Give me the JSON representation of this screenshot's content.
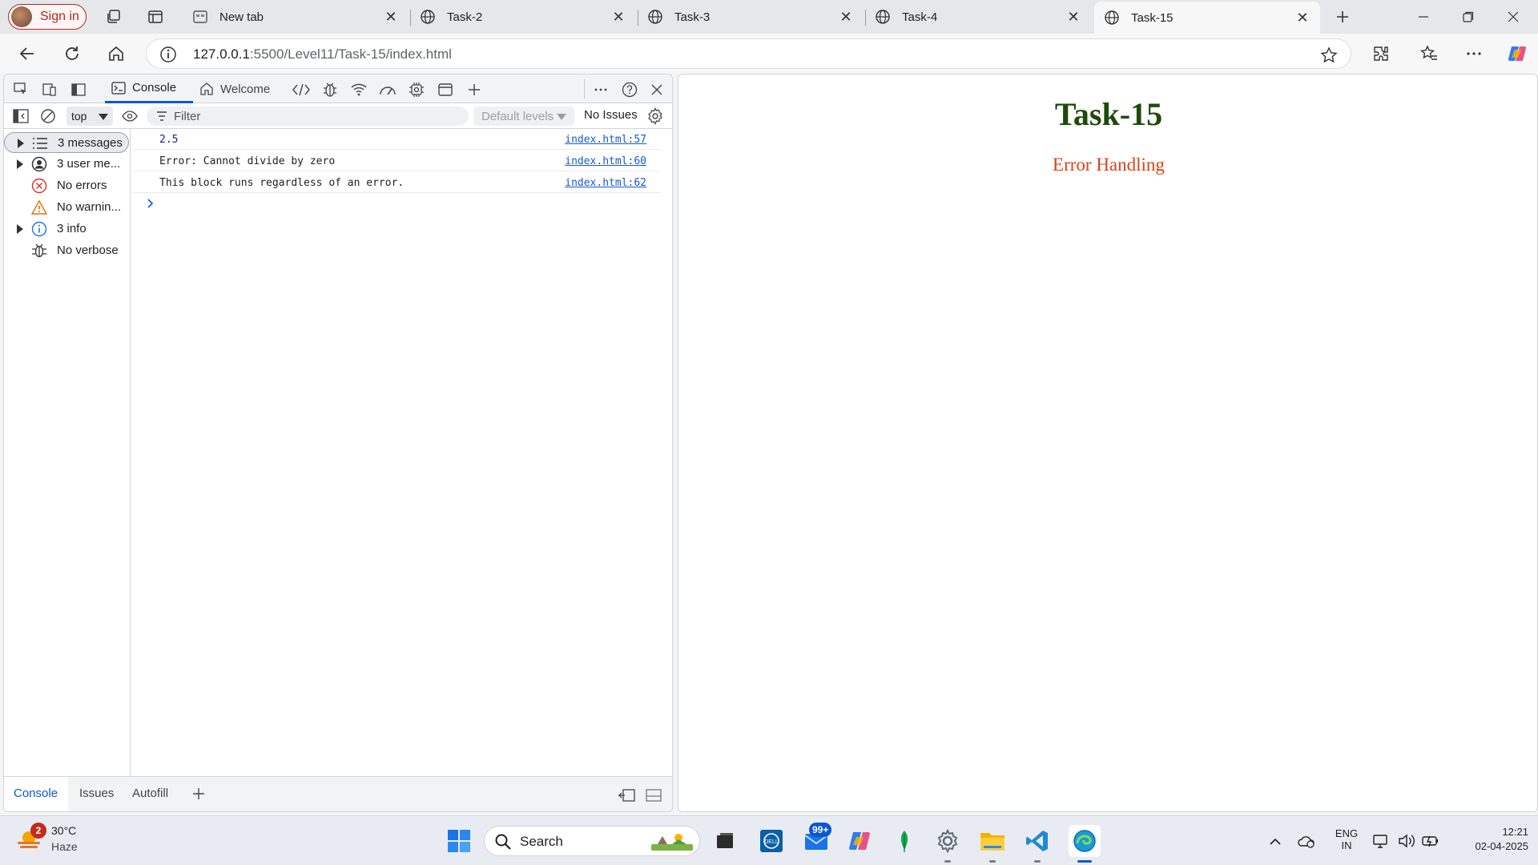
{
  "browser": {
    "signin_label": "Sign in",
    "tabs": [
      {
        "label": "New tab"
      },
      {
        "label": "Task-2"
      },
      {
        "label": "Task-3"
      },
      {
        "label": "Task-4"
      },
      {
        "label": "Task-15",
        "active": true
      }
    ],
    "url_host": "127.0.0.1",
    "url_rest": ":5500/Level11/Task-15/index.html"
  },
  "devtools": {
    "tabs": {
      "console": "Console",
      "welcome": "Welcome"
    },
    "context": "top",
    "filter_placeholder": "Filter",
    "levels": "Default levels",
    "issues": "No Issues",
    "sidebar": [
      {
        "label": "3 messages",
        "icon": "list-icon",
        "expandable": true,
        "selected": true
      },
      {
        "label": "3 user me...",
        "icon": "user-icon",
        "expandable": true
      },
      {
        "label": "No errors",
        "icon": "error-icon"
      },
      {
        "label": "No warnin...",
        "icon": "warning-icon"
      },
      {
        "label": "3 info",
        "icon": "info-icon",
        "expandable": true
      },
      {
        "label": "No verbose",
        "icon": "bug-icon"
      }
    ],
    "logs": [
      {
        "message": "2.5",
        "source": "index.html:57"
      },
      {
        "message": "Error: Cannot divide by zero",
        "source": "index.html:60"
      },
      {
        "message": "This block runs regardless of an error.",
        "source": "index.html:62"
      }
    ],
    "drawer_tabs": {
      "console": "Console",
      "issues": "Issues",
      "autofill": "Autofill"
    }
  },
  "page": {
    "title": "Task-15",
    "subtitle": "Error Handling"
  },
  "taskbar": {
    "weather_badge": "2",
    "temperature": "30°C",
    "weather": "Haze",
    "search_label": "Search",
    "mail_badge": "99+",
    "language": "ENG",
    "region": "IN",
    "time": "12:21",
    "date": "02-04-2025"
  },
  "colors": {
    "page_title": "#1e4a0a",
    "page_subtitle": "#d84315",
    "accent": "#0b57d0",
    "signin": "#b3261e"
  }
}
